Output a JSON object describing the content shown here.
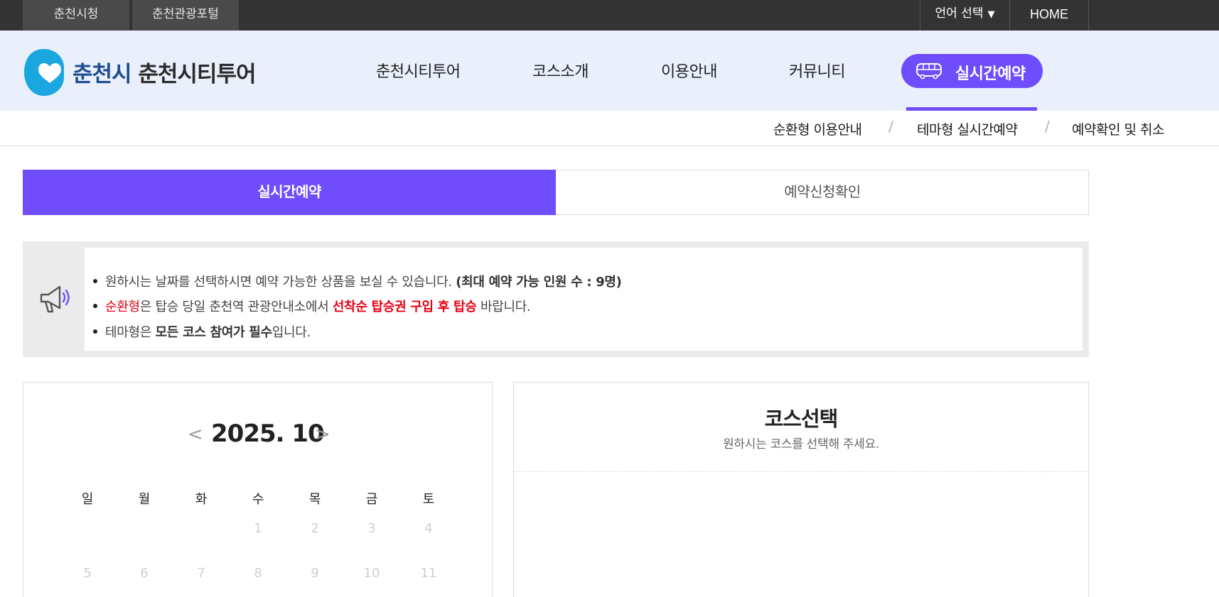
{
  "topbar": {
    "links": [
      "춘천시청",
      "춘천관광포털"
    ],
    "language": "언어 선택",
    "language_caret": "▼",
    "home": "HOME"
  },
  "header": {
    "logo_city": "춘천시",
    "logo_name": "춘천시티투어",
    "nav": [
      "춘천시티투어",
      "코스소개",
      "이용안내",
      "커뮤니티"
    ],
    "reserve_button": "실시간예약",
    "accent_color": "#6f4dfc",
    "logo_color": "#1aa7e0"
  },
  "subnav": {
    "items": [
      "순환형 이용안내",
      "테마형 실시간예약",
      "예약확인 및 취소"
    ],
    "separator": "/"
  },
  "tabs": [
    "실시간예약",
    "예약신청확인"
  ],
  "notice": {
    "icon": "megaphone-icon",
    "line1_text": "원하시는 날짜를 선택하시면 예약 가능한 상품을 보실 수 있습니다. ",
    "line1_bold": "(최대 예약 가능 인원 수 : 9명)",
    "line2_red": "순환형",
    "line2_text_a": "은 탑승 당일 춘천역 관광안내소에서 ",
    "line2_red_bold": "선착순 탑승권 구입 후 탑승",
    "line2_text_b": " 바랍니다.",
    "line3_text_a": "테마형은 ",
    "line3_bold": "모든 코스 참여가 필수",
    "line3_text_b": "입니다."
  },
  "calendar": {
    "prev": "<",
    "next": ">",
    "title": "2025. 10",
    "weekdays": [
      "일",
      "월",
      "화",
      "수",
      "목",
      "금",
      "토"
    ],
    "days": [
      "1",
      "2",
      "3",
      "4",
      "5",
      "6",
      "7",
      "8",
      "9",
      "10",
      "11"
    ]
  },
  "course": {
    "title": "코스선택",
    "subtitle": "원하시는 코스를 선택해 주세요."
  }
}
